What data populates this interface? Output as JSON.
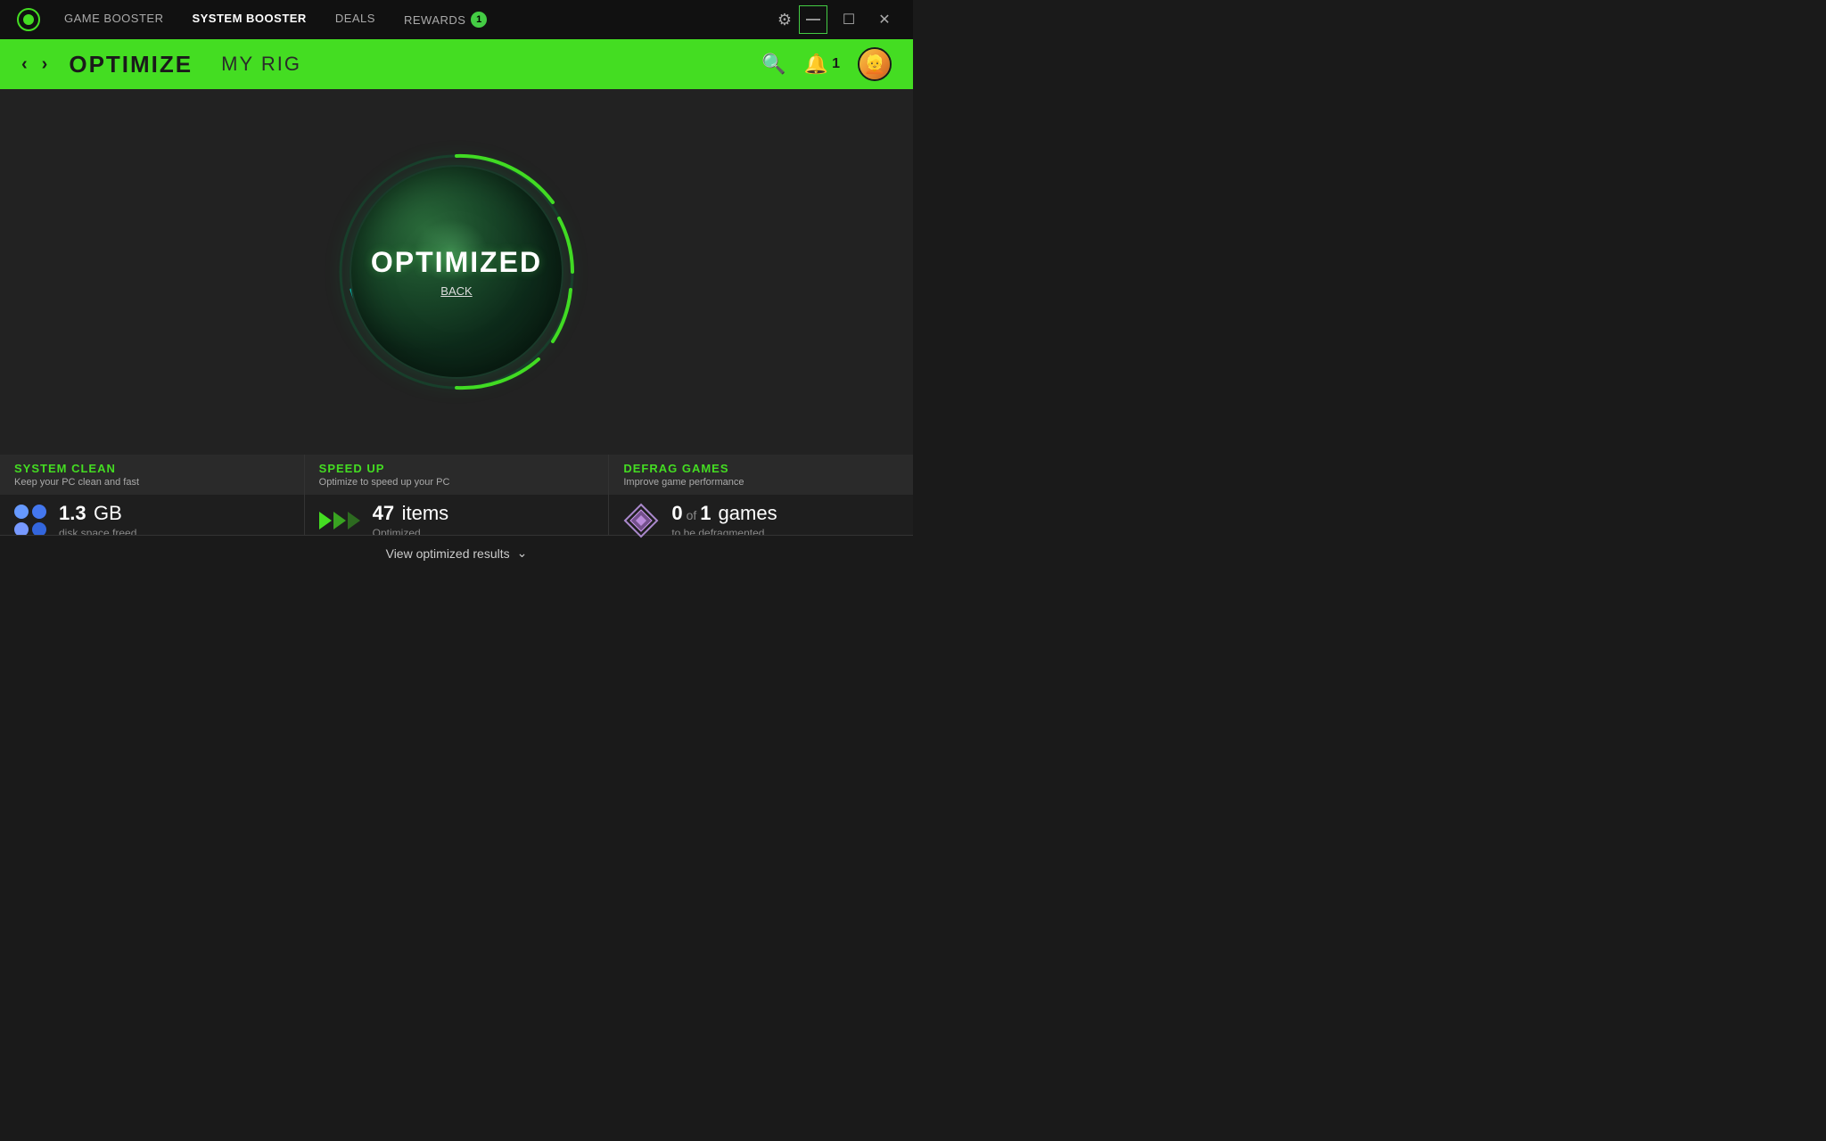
{
  "app": {
    "logo_alt": "Razer Cortex Logo"
  },
  "top_nav": {
    "items": [
      {
        "label": "GAME BOOSTER",
        "active": false
      },
      {
        "label": "SYSTEM BOOSTER",
        "active": true
      },
      {
        "label": "DEALS",
        "active": false
      },
      {
        "label": "REWARDS",
        "active": false
      }
    ],
    "rewards_badge": "1",
    "settings_label": "⚙",
    "minimize_label": "—",
    "maximize_label": "☐",
    "close_label": "✕"
  },
  "sub_nav": {
    "back_arrow": "‹",
    "forward_arrow": "›",
    "title": "OPTIMIZE",
    "secondary": "MY RIG",
    "search_icon": "🔍",
    "notif_count": "1",
    "avatar_emoji": "👱"
  },
  "main": {
    "optimized_label": "OPTIMIZED",
    "back_link": "BACK"
  },
  "stats": {
    "cards": [
      {
        "id": "system-clean",
        "title": "SYSTEM CLEAN",
        "subtitle": "Keep your PC clean and fast",
        "value": "1.3",
        "unit": "GB",
        "description": "disk space freed"
      },
      {
        "id": "speed-up",
        "title": "SPEED UP",
        "subtitle": "Optimize to speed up your PC",
        "value": "47",
        "unit": "items",
        "description": "Optimized"
      },
      {
        "id": "defrag-games",
        "title": "DEFRAG GAMES",
        "subtitle": "Improve game performance",
        "value": "0",
        "unit_pre": "of",
        "unit_post": "games",
        "description": "to be defragmented",
        "extra": "1"
      }
    ],
    "view_results": "View optimized results"
  }
}
